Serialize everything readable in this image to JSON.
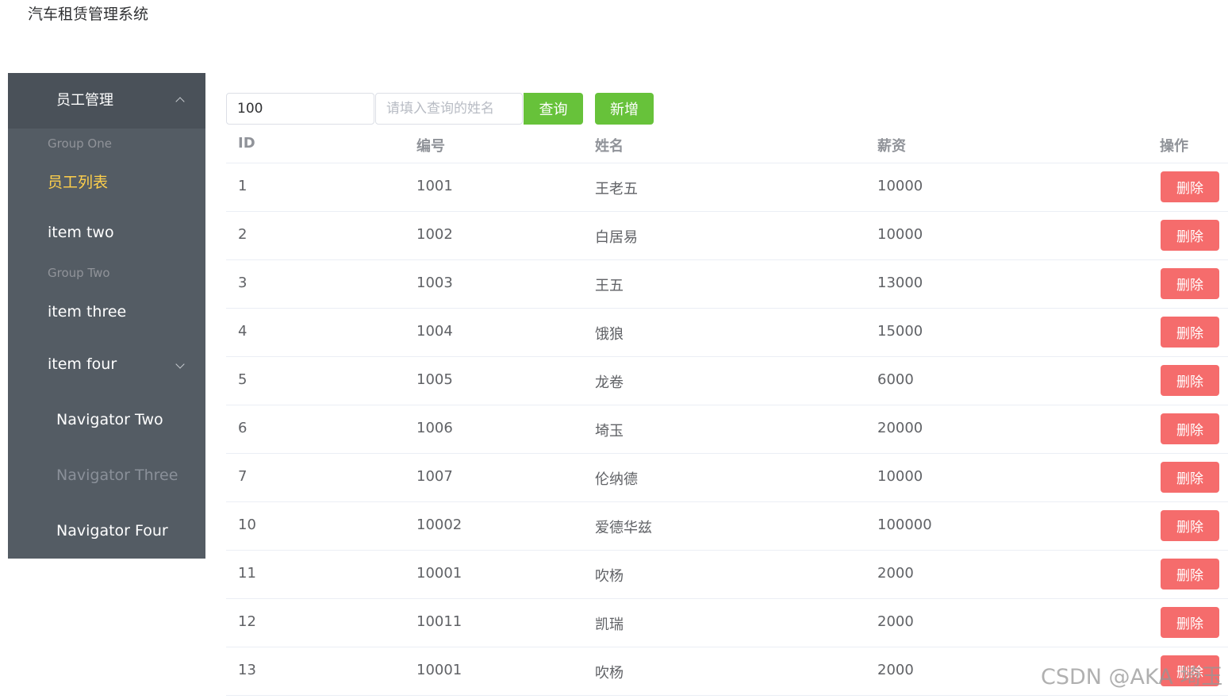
{
  "app": {
    "title": "汽车租赁管理系统"
  },
  "sidebar": {
    "header": "员工管理",
    "group_one": "Group One",
    "item_list": "员工列表",
    "item_two": "item two",
    "group_two": "Group Two",
    "item_three": "item three",
    "item_four": "item four",
    "nav_two": "Navigator Two",
    "nav_three": "Navigator Three",
    "nav_four": "Navigator Four"
  },
  "toolbar": {
    "id_value": "100",
    "name_placeholder": "请填入查询的姓名",
    "query_label": "查询",
    "add_label": "新增"
  },
  "table": {
    "headers": [
      "ID",
      "编号",
      "姓名",
      "薪资",
      "操作"
    ],
    "delete_label": "删除",
    "rows": [
      {
        "id": "1",
        "code": "1001",
        "name": "王老五",
        "salary": "10000"
      },
      {
        "id": "2",
        "code": "1002",
        "name": "白居易",
        "salary": "10000"
      },
      {
        "id": "3",
        "code": "1003",
        "name": "王五",
        "salary": "13000"
      },
      {
        "id": "4",
        "code": "1004",
        "name": "饿狼",
        "salary": "15000"
      },
      {
        "id": "5",
        "code": "1005",
        "name": "龙卷",
        "salary": "6000"
      },
      {
        "id": "6",
        "code": "1006",
        "name": "埼玉",
        "salary": "20000"
      },
      {
        "id": "7",
        "code": "1007",
        "name": "伦纳德",
        "salary": "10000"
      },
      {
        "id": "10",
        "code": "10002",
        "name": "爱德华兹",
        "salary": "100000"
      },
      {
        "id": "11",
        "code": "10001",
        "name": "吹杨",
        "salary": "2000"
      },
      {
        "id": "12",
        "code": "10011",
        "name": "凯瑞",
        "salary": "2000"
      },
      {
        "id": "13",
        "code": "10001",
        "name": "吹杨",
        "salary": "2000"
      }
    ]
  },
  "watermark": "CSDN @AKA 埼玉",
  "colors": {
    "sidebar_bg": "#545c64",
    "active_text": "#ffd04b",
    "success": "#67c23a",
    "danger": "#f56c6c"
  }
}
